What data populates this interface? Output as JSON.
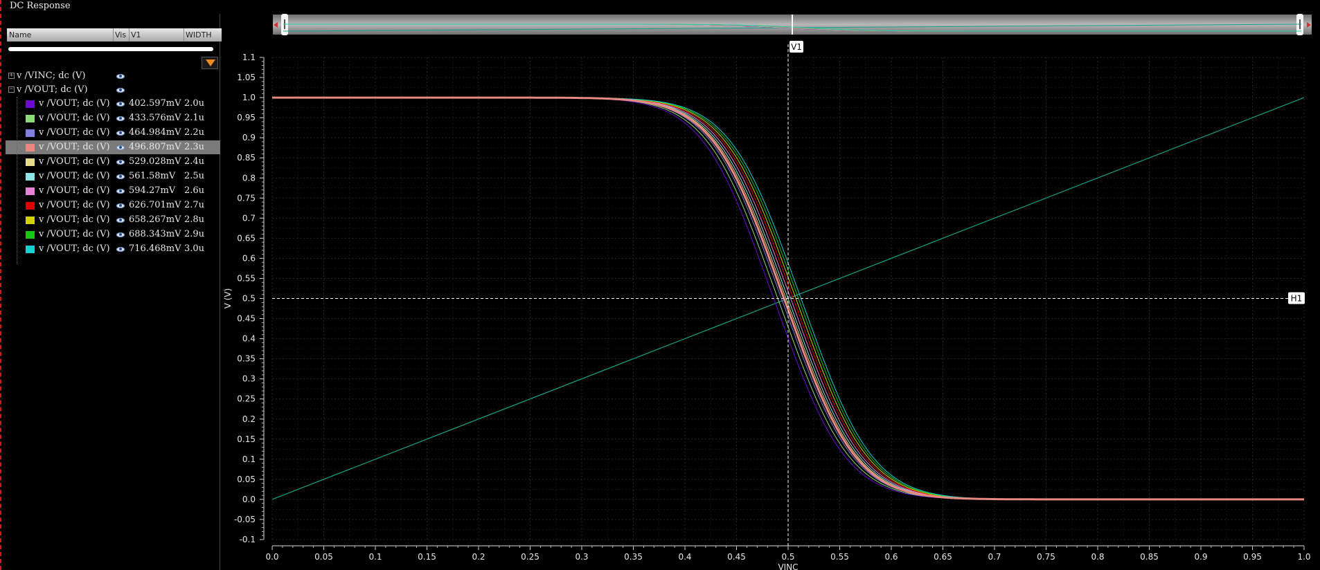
{
  "window": {
    "title": "DC Response"
  },
  "columns": {
    "name": "Name",
    "vis": "Vis",
    "v1": "V1",
    "width": "WIDTH"
  },
  "tree": {
    "groups": [
      {
        "label": "v /VINC; dc (V)",
        "expander": "+"
      },
      {
        "label": "v /VOUT; dc (V)",
        "expander": "−"
      }
    ],
    "traces": [
      {
        "label": "v /VOUT; dc (V)",
        "color": "#6a0ad2",
        "v1": "402.597mV",
        "width": "2.0u"
      },
      {
        "label": "v /VOUT; dc (V)",
        "color": "#8cdc78",
        "v1": "433.576mV",
        "width": "2.1u"
      },
      {
        "label": "v /VOUT; dc (V)",
        "color": "#8080e0",
        "v1": "464.984mV",
        "width": "2.2u"
      },
      {
        "label": "v /VOUT; dc (V)",
        "color": "#e88880",
        "v1": "496.807mV",
        "width": "2.3u",
        "selected": true
      },
      {
        "label": "v /VOUT; dc (V)",
        "color": "#e6dc8c",
        "v1": "529.028mV",
        "width": "2.4u"
      },
      {
        "label": "v /VOUT; dc (V)",
        "color": "#8ce6e6",
        "v1": "561.58mV",
        "width": "2.5u"
      },
      {
        "label": "v /VOUT; dc (V)",
        "color": "#e882d8",
        "v1": "594.27mV",
        "width": "2.6u"
      },
      {
        "label": "v /VOUT; dc (V)",
        "color": "#e00000",
        "v1": "626.701mV",
        "width": "2.7u"
      },
      {
        "label": "v /VOUT; dc (V)",
        "color": "#d2d200",
        "v1": "658.267mV",
        "width": "2.8u"
      },
      {
        "label": "v /VOUT; dc (V)",
        "color": "#14c814",
        "v1": "688.343mV",
        "width": "2.9u"
      },
      {
        "label": "v /VOUT; dc (V)",
        "color": "#14d2d2",
        "v1": "716.468mV",
        "width": "3.0u"
      }
    ]
  },
  "chart_data": {
    "type": "line",
    "xlabel": "VINC",
    "ylabel": "V (V)",
    "xlim": [
      0,
      1
    ],
    "ylim": [
      -0.1,
      1.1
    ],
    "x_ticks": [
      "0.0",
      "0.05",
      "0.1",
      "0.15",
      "0.2",
      "0.25",
      "0.3",
      "0.35",
      "0.4",
      "0.45",
      "0.5",
      "0.55",
      "0.6",
      "0.65",
      "0.7",
      "0.75",
      "0.8",
      "0.85",
      "0.9",
      "0.95",
      "1.0"
    ],
    "y_ticks": [
      "1.1",
      "1.05",
      "1.0",
      "0.95",
      "0.9",
      "0.85",
      "0.8",
      "0.75",
      "0.7",
      "0.65",
      "0.6",
      "0.55",
      "0.5",
      "0.45",
      "0.4",
      "0.35",
      "0.3",
      "0.25",
      "0.2",
      "0.15",
      "0.1",
      "0.05",
      "0.0",
      "-0.05",
      "-0.1"
    ],
    "grid": true,
    "markers": {
      "vertical": {
        "label": "V1",
        "x": 0.5
      },
      "horizontal": {
        "label": "H1",
        "y": 0.5
      }
    },
    "ramp": {
      "color": "#14a088",
      "x": [
        0,
        1
      ],
      "y": [
        0,
        1
      ]
    },
    "vout_sweep": {
      "x_switch": [
        0.486,
        0.49,
        0.4935,
        0.496,
        0.498,
        0.5,
        0.5025,
        0.505,
        0.5075,
        0.51,
        0.5125
      ]
    }
  }
}
